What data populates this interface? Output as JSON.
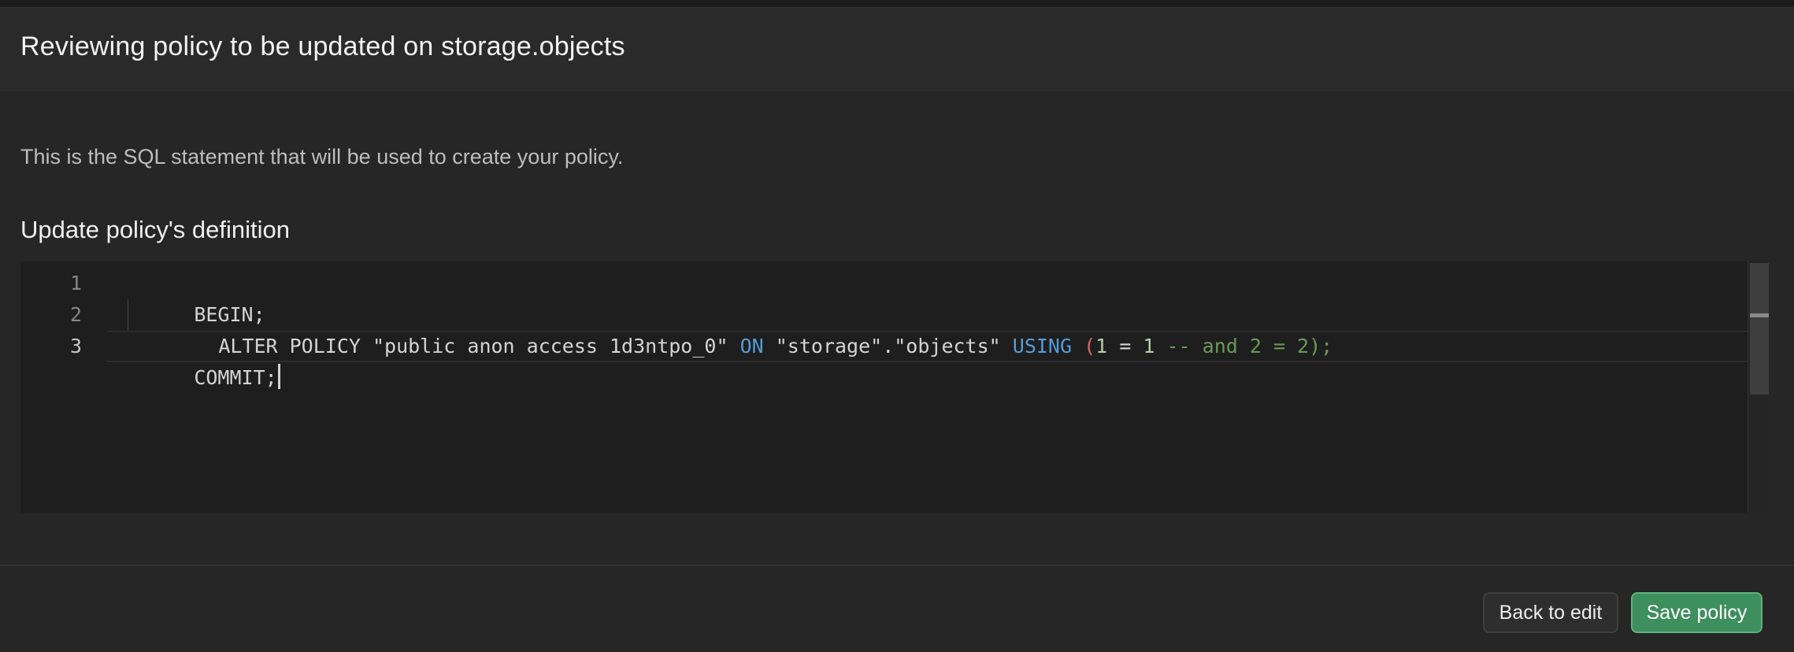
{
  "header": {
    "title": "Reviewing policy to be updated on storage.objects"
  },
  "body": {
    "description": "This is the SQL statement that will be used to create your policy.",
    "section_title": "Update policy's definition"
  },
  "editor": {
    "line_numbers": [
      "1",
      "2",
      "3"
    ],
    "lines": {
      "l1": "BEGIN;",
      "l2": {
        "t1": "ALTER POLICY \"public anon access 1d3ntpo_0\" ",
        "t2": "ON",
        "t3": " \"storage\".\"objects\" ",
        "t4": "USING",
        "t5": " ",
        "t6": "(",
        "t7": "1",
        "t8": " = ",
        "t9": "1",
        "t10": " -- and 2 = 2);"
      },
      "l3": "COMMIT;"
    }
  },
  "footer": {
    "back_label": "Back to edit",
    "save_label": "Save policy"
  },
  "colors": {
    "keyword": "#569cd6",
    "paren": "#d16969",
    "number": "#b5cea8",
    "comment": "#6a9955",
    "primary_button": "#3e8f5e"
  }
}
